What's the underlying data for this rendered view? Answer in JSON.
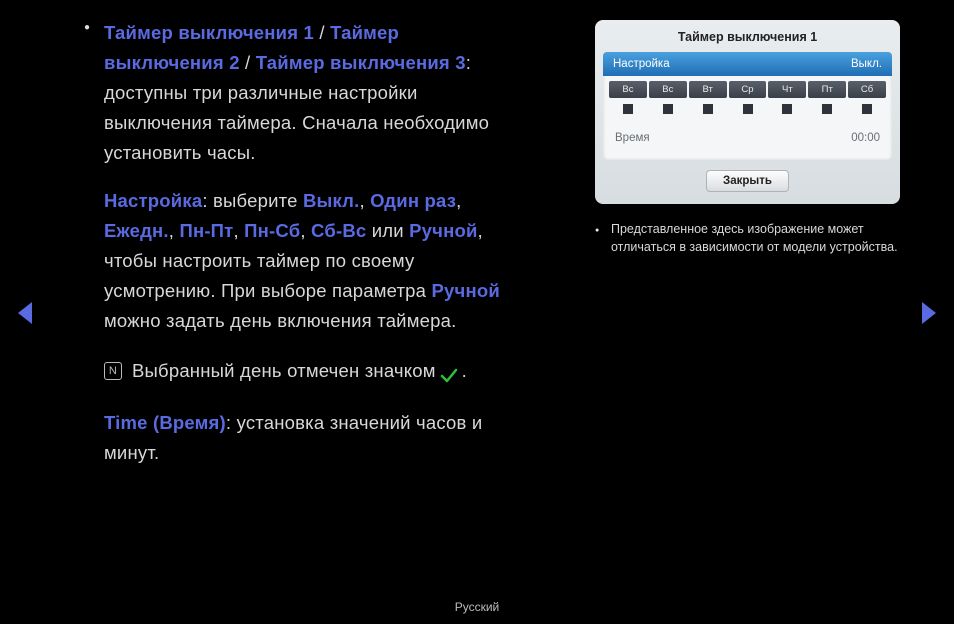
{
  "left": {
    "p1_kw1": "Таймер выключения 1",
    "p1_sep1": " / ",
    "p1_kw2": "Таймер выключения 2",
    "p1_sep2": " / ",
    "p1_kw3": "Таймер выключения 3",
    "p1_tail": ": доступны три различные настройки выключения таймера. Сначала необходимо установить часы.",
    "p2_kw1": "Настройка",
    "p2_t1": ": выберите ",
    "p2_kw2": "Выкл.",
    "p2_t2": ", ",
    "p2_kw3": "Один раз",
    "p2_t3": ", ",
    "p2_kw4": "Ежедн.",
    "p2_t4": ", ",
    "p2_kw5": "Пн-Пт",
    "p2_t5": ", ",
    "p2_kw6": "Пн-Сб",
    "p2_t6": ", ",
    "p2_kw7": "Сб-Вс",
    "p2_t7": " или ",
    "p2_kw8": "Ручной",
    "p2_t8": ", чтобы настроить таймер по своему усмотрению. При выборе параметра ",
    "p2_kw9": "Ручной",
    "p2_t9": " можно задать день включения таймера.",
    "note_text_a": "Выбранный день отмечен значком ",
    "note_text_b": ".",
    "p3_kw1": "Time (Время)",
    "p3_tail": ": установка значений часов и минут."
  },
  "dialog": {
    "title": "Таймер выключения 1",
    "setup_label": "Настройка",
    "setup_value": "Выкл.",
    "days": [
      "Вс",
      "Вс",
      "Вт",
      "Ср",
      "Чт",
      "Пт",
      "Сб"
    ],
    "time_label": "Время",
    "time_value": "00:00",
    "close": "Закрыть"
  },
  "disclaimer": "Представленное здесь изображение может отличаться в зависимости от модели устройства.",
  "footer": "Русский"
}
